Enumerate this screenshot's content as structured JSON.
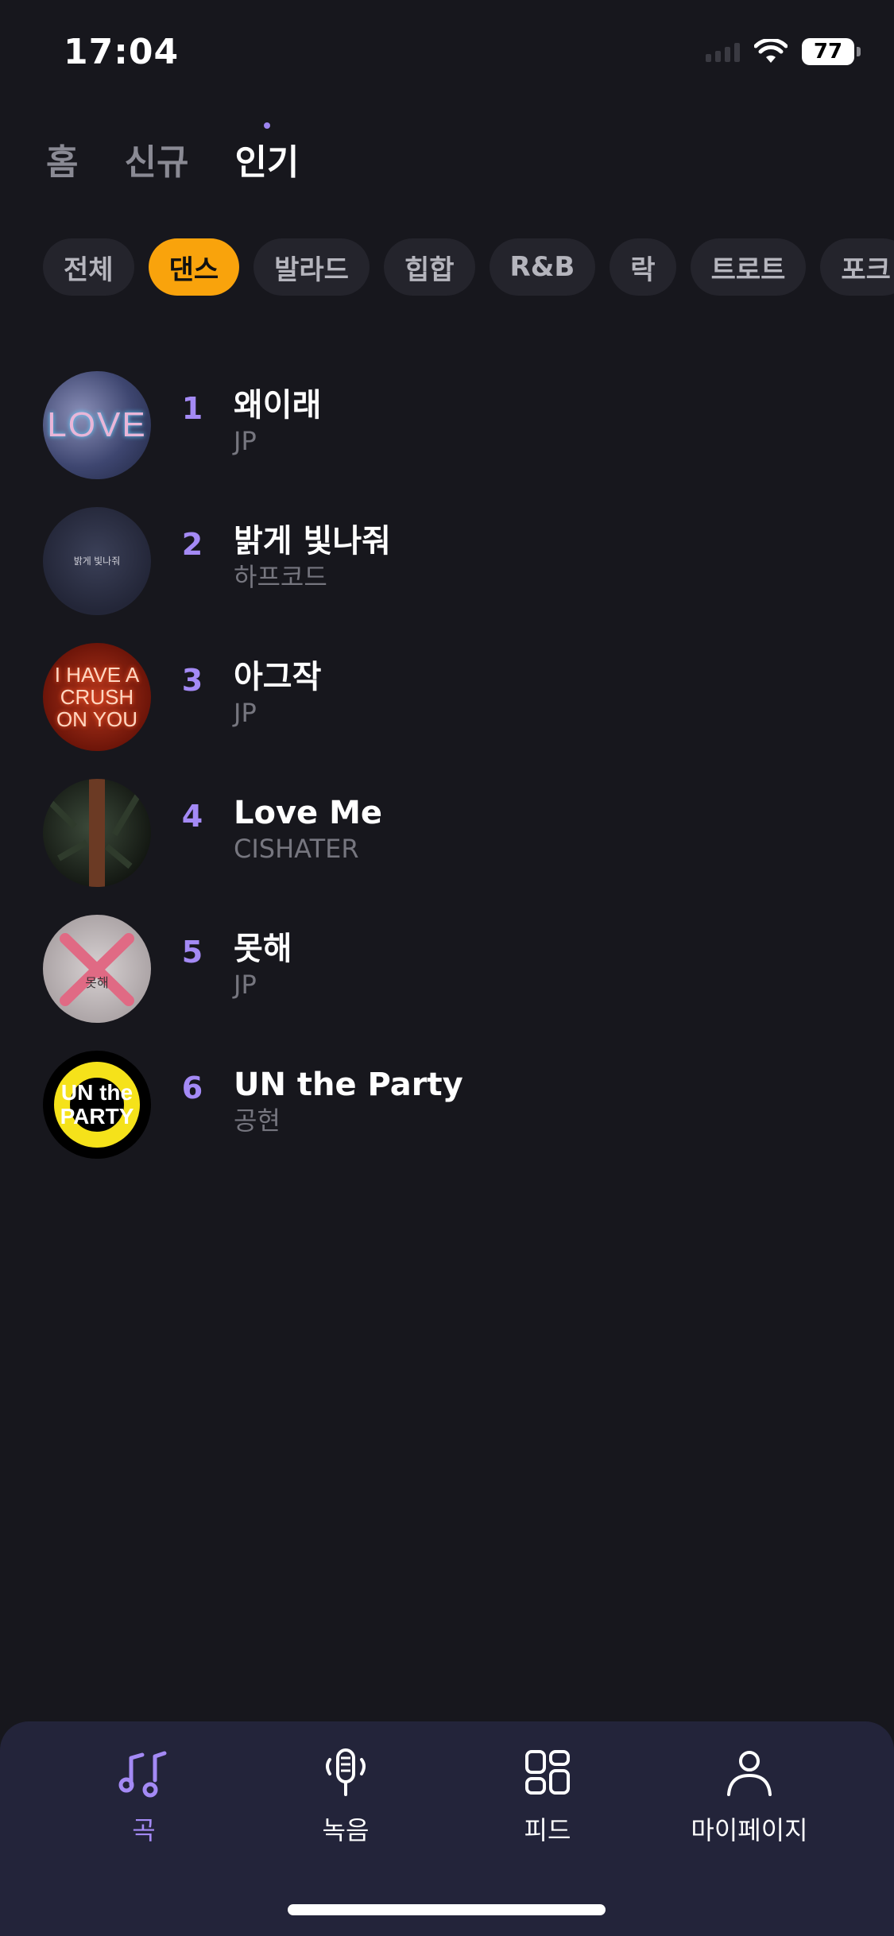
{
  "status_bar": {
    "time": "17:04",
    "battery": "77"
  },
  "top_tabs": [
    {
      "label": "홈"
    },
    {
      "label": "신규"
    },
    {
      "label": "인기"
    }
  ],
  "active_top_tab": "인기",
  "genres": [
    {
      "label": "전체"
    },
    {
      "label": "댄스"
    },
    {
      "label": "발라드"
    },
    {
      "label": "힙합"
    },
    {
      "label": "R&B"
    },
    {
      "label": "락"
    },
    {
      "label": "트로트"
    },
    {
      "label": "포크"
    }
  ],
  "active_genre": "댄스",
  "songs": [
    {
      "rank": "1",
      "title": "왜이래",
      "artist": "JP",
      "cover_text": "LOVE"
    },
    {
      "rank": "2",
      "title": "밝게 빛나줘",
      "artist": "하프코드",
      "cover_text": "밝게 빛나줘"
    },
    {
      "rank": "3",
      "title": "아그작",
      "artist": "JP",
      "cover_text": "I HAVE A CRUSH ON YOU"
    },
    {
      "rank": "4",
      "title": "Love Me",
      "artist": "CISHATER",
      "cover_text": ""
    },
    {
      "rank": "5",
      "title": "못해",
      "artist": "JP",
      "cover_text": "못해"
    },
    {
      "rank": "6",
      "title": "UN the Party",
      "artist": "공현",
      "cover_text": "UN the PARTY"
    }
  ],
  "bottom_nav": [
    {
      "label": "곡",
      "icon": "music-notes-icon"
    },
    {
      "label": "녹음",
      "icon": "microphone-icon"
    },
    {
      "label": "피드",
      "icon": "grid-icon"
    },
    {
      "label": "마이페이지",
      "icon": "person-icon"
    }
  ],
  "colors": {
    "background": "#17171d",
    "accent_purple": "#a48af5",
    "active_chip": "#f9a30c",
    "chip_bg": "#24242c",
    "nav_bg": "#23243a"
  }
}
